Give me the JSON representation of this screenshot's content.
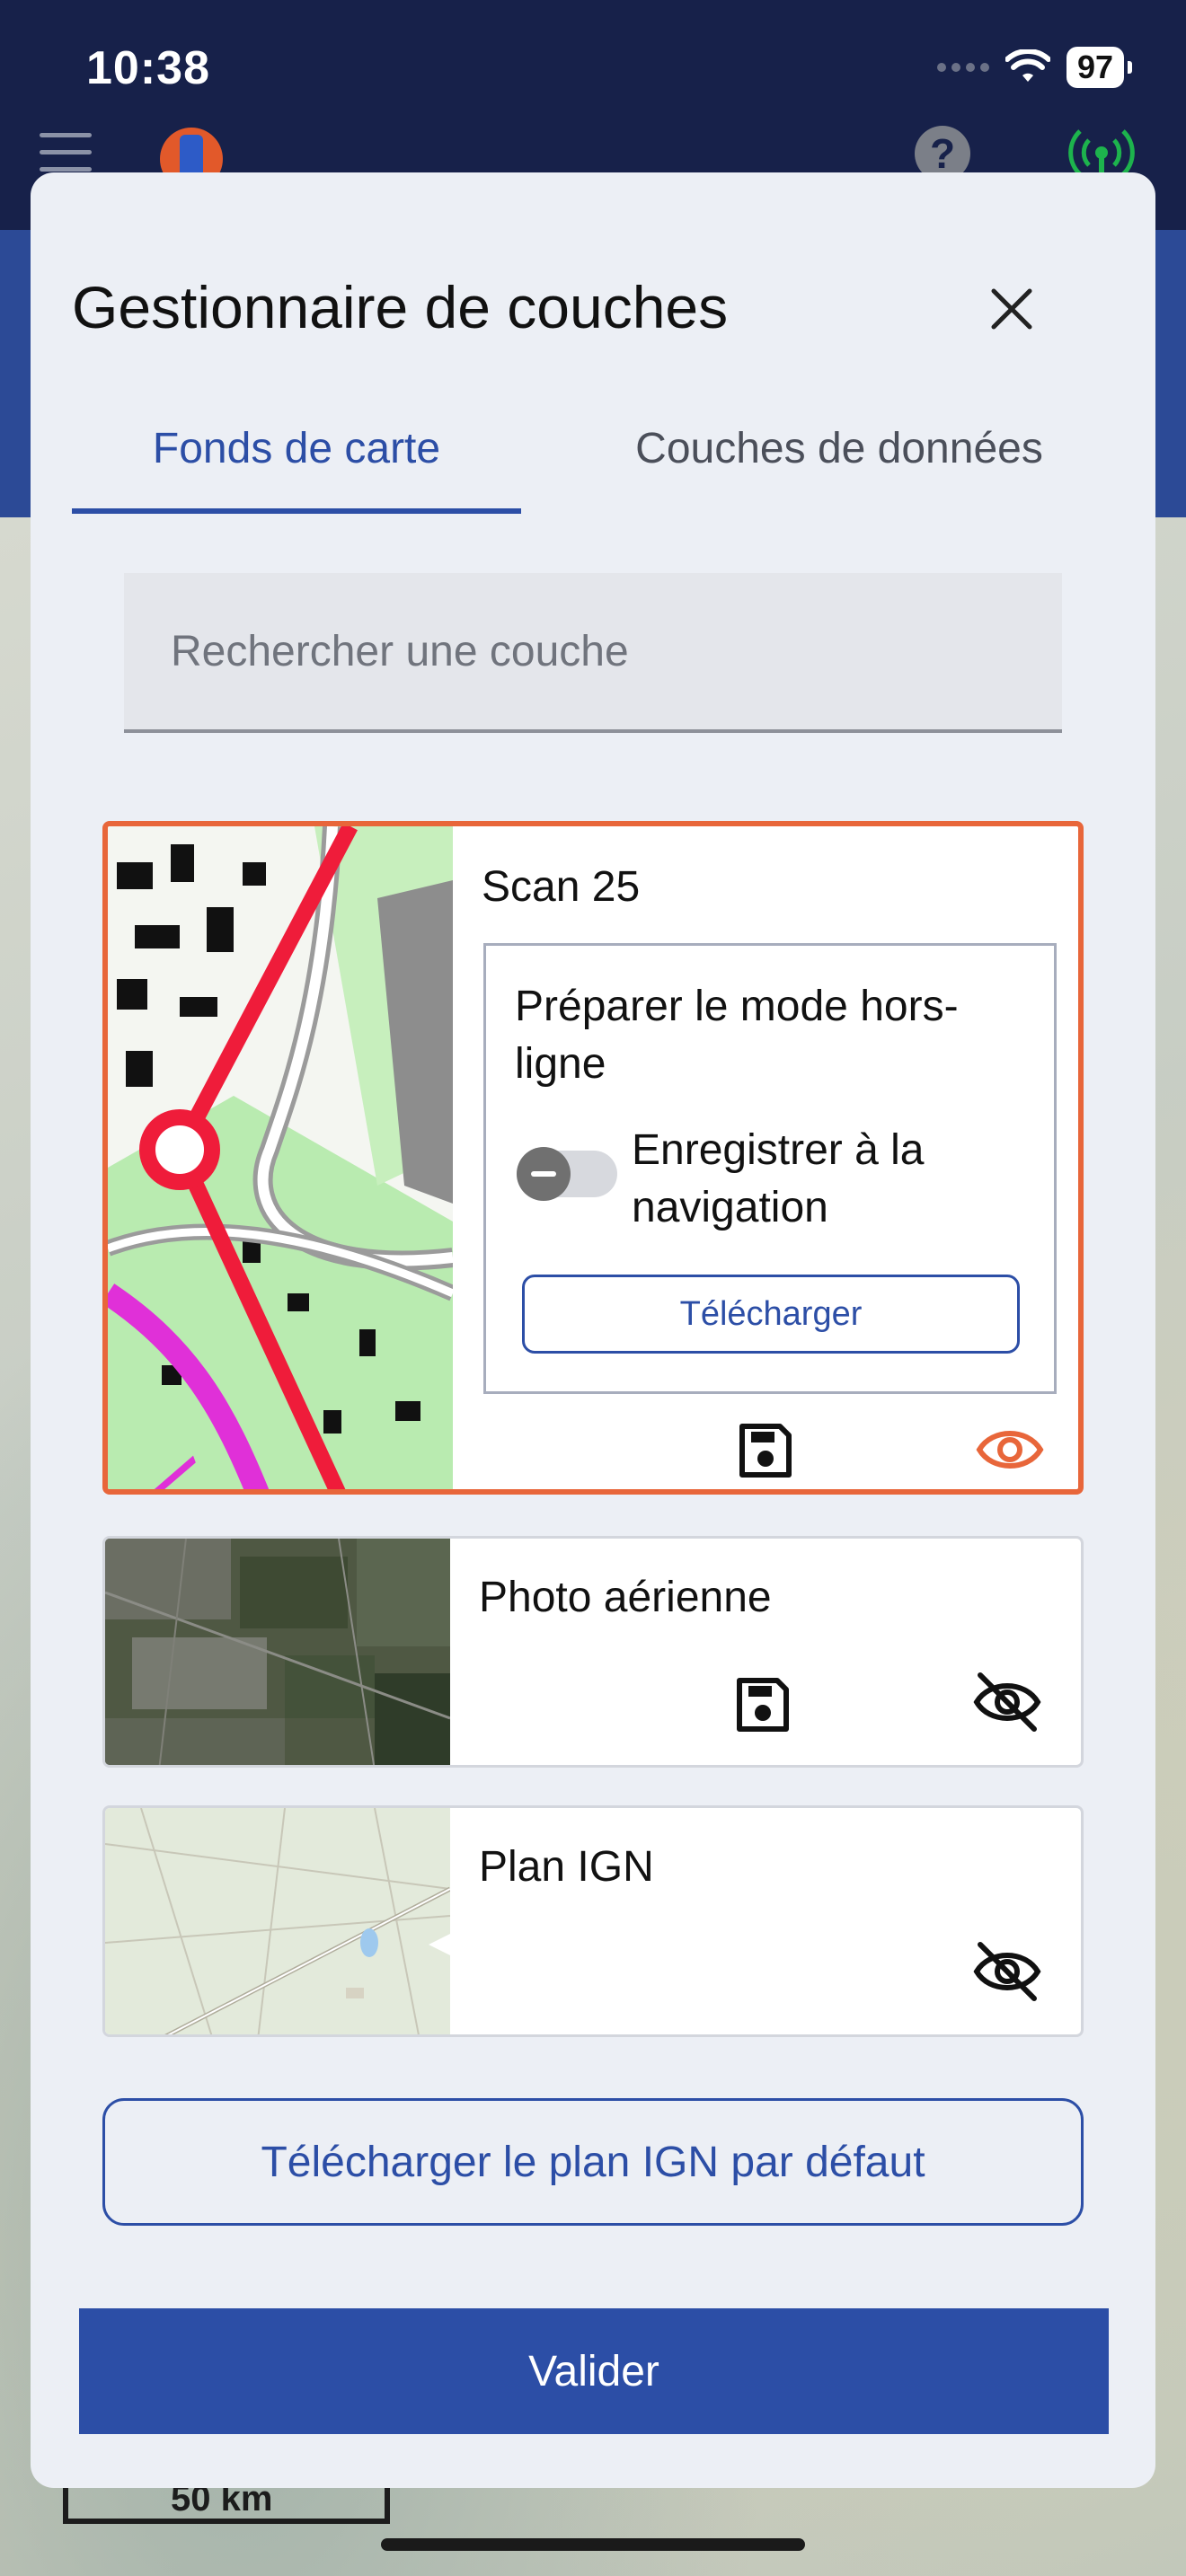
{
  "status_bar": {
    "time": "10:38",
    "battery": "97"
  },
  "background": {
    "scale_label": "50 km"
  },
  "modal": {
    "title": "Gestionnaire de couches",
    "tabs": [
      {
        "label": "Fonds de carte",
        "active": true
      },
      {
        "label": "Couches de données",
        "active": false
      }
    ],
    "search": {
      "placeholder": "Rechercher une couche",
      "value": ""
    },
    "layers": [
      {
        "name": "Scan 25",
        "selected": true,
        "visible": true,
        "offline": {
          "title": "Préparer le mode hors-ligne",
          "toggle_label": "Enregistrer à la navigation",
          "toggle_on": false,
          "download_label": "Télécharger"
        }
      },
      {
        "name": "Photo aérienne",
        "selected": false,
        "visible": false
      },
      {
        "name": "Plan IGN",
        "selected": false,
        "visible": false
      }
    ],
    "default_download_label": "Télécharger le plan IGN par défaut",
    "validate_label": "Valider"
  },
  "colors": {
    "accent": "#2c4ea6",
    "selected_border": "#e8663a",
    "header_bg": "#17214a",
    "visible_icon": "#e8663a",
    "connected_icon": "#1db34d"
  },
  "icons": [
    "menu-icon",
    "logo-icon",
    "help-icon",
    "antenna-icon",
    "close-icon",
    "save-icon",
    "eye-icon",
    "eye-off-icon",
    "wifi-icon"
  ]
}
